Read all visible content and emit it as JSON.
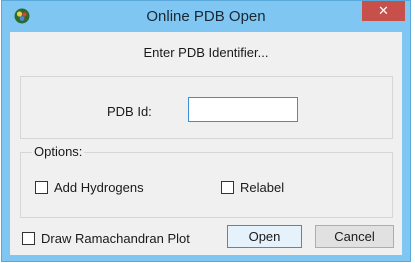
{
  "window": {
    "title": "Online PDB Open",
    "close_symbol": "✕",
    "app_icon": "molecule-app-icon"
  },
  "dialog": {
    "prompt": "Enter PDB Identifier...",
    "pdb_id_label": "PDB Id:",
    "pdb_id_value": "",
    "options_label": "Options:",
    "add_hydrogens_label": "Add Hydrogens",
    "add_hydrogens_checked": false,
    "relabel_label": "Relabel",
    "relabel_checked": false,
    "ramachandran_label": "Draw Ramachandran Plot",
    "ramachandran_checked": false
  },
  "buttons": {
    "open_label": "Open",
    "cancel_label": "Cancel"
  },
  "colors": {
    "titlebar": "#7fc7f2",
    "close_button": "#c7504a",
    "focus_border": "#3c8ed9"
  }
}
